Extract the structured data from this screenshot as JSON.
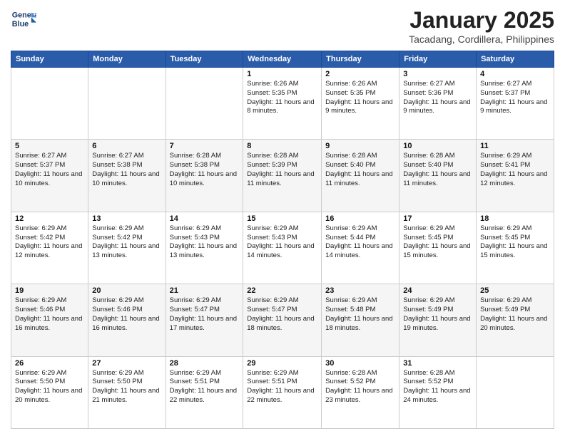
{
  "logo": {
    "line1": "General",
    "line2": "Blue"
  },
  "title": "January 2025",
  "location": "Tacadang, Cordillera, Philippines",
  "days_of_week": [
    "Sunday",
    "Monday",
    "Tuesday",
    "Wednesday",
    "Thursday",
    "Friday",
    "Saturday"
  ],
  "weeks": [
    [
      {
        "day": "",
        "sunrise": "",
        "sunset": "",
        "daylight": ""
      },
      {
        "day": "",
        "sunrise": "",
        "sunset": "",
        "daylight": ""
      },
      {
        "day": "",
        "sunrise": "",
        "sunset": "",
        "daylight": ""
      },
      {
        "day": "1",
        "sunrise": "Sunrise: 6:26 AM",
        "sunset": "Sunset: 5:35 PM",
        "daylight": "Daylight: 11 hours and 8 minutes."
      },
      {
        "day": "2",
        "sunrise": "Sunrise: 6:26 AM",
        "sunset": "Sunset: 5:35 PM",
        "daylight": "Daylight: 11 hours and 9 minutes."
      },
      {
        "day": "3",
        "sunrise": "Sunrise: 6:27 AM",
        "sunset": "Sunset: 5:36 PM",
        "daylight": "Daylight: 11 hours and 9 minutes."
      },
      {
        "day": "4",
        "sunrise": "Sunrise: 6:27 AM",
        "sunset": "Sunset: 5:37 PM",
        "daylight": "Daylight: 11 hours and 9 minutes."
      }
    ],
    [
      {
        "day": "5",
        "sunrise": "Sunrise: 6:27 AM",
        "sunset": "Sunset: 5:37 PM",
        "daylight": "Daylight: 11 hours and 10 minutes."
      },
      {
        "day": "6",
        "sunrise": "Sunrise: 6:27 AM",
        "sunset": "Sunset: 5:38 PM",
        "daylight": "Daylight: 11 hours and 10 minutes."
      },
      {
        "day": "7",
        "sunrise": "Sunrise: 6:28 AM",
        "sunset": "Sunset: 5:38 PM",
        "daylight": "Daylight: 11 hours and 10 minutes."
      },
      {
        "day": "8",
        "sunrise": "Sunrise: 6:28 AM",
        "sunset": "Sunset: 5:39 PM",
        "daylight": "Daylight: 11 hours and 11 minutes."
      },
      {
        "day": "9",
        "sunrise": "Sunrise: 6:28 AM",
        "sunset": "Sunset: 5:40 PM",
        "daylight": "Daylight: 11 hours and 11 minutes."
      },
      {
        "day": "10",
        "sunrise": "Sunrise: 6:28 AM",
        "sunset": "Sunset: 5:40 PM",
        "daylight": "Daylight: 11 hours and 11 minutes."
      },
      {
        "day": "11",
        "sunrise": "Sunrise: 6:29 AM",
        "sunset": "Sunset: 5:41 PM",
        "daylight": "Daylight: 11 hours and 12 minutes."
      }
    ],
    [
      {
        "day": "12",
        "sunrise": "Sunrise: 6:29 AM",
        "sunset": "Sunset: 5:42 PM",
        "daylight": "Daylight: 11 hours and 12 minutes."
      },
      {
        "day": "13",
        "sunrise": "Sunrise: 6:29 AM",
        "sunset": "Sunset: 5:42 PM",
        "daylight": "Daylight: 11 hours and 13 minutes."
      },
      {
        "day": "14",
        "sunrise": "Sunrise: 6:29 AM",
        "sunset": "Sunset: 5:43 PM",
        "daylight": "Daylight: 11 hours and 13 minutes."
      },
      {
        "day": "15",
        "sunrise": "Sunrise: 6:29 AM",
        "sunset": "Sunset: 5:43 PM",
        "daylight": "Daylight: 11 hours and 14 minutes."
      },
      {
        "day": "16",
        "sunrise": "Sunrise: 6:29 AM",
        "sunset": "Sunset: 5:44 PM",
        "daylight": "Daylight: 11 hours and 14 minutes."
      },
      {
        "day": "17",
        "sunrise": "Sunrise: 6:29 AM",
        "sunset": "Sunset: 5:45 PM",
        "daylight": "Daylight: 11 hours and 15 minutes."
      },
      {
        "day": "18",
        "sunrise": "Sunrise: 6:29 AM",
        "sunset": "Sunset: 5:45 PM",
        "daylight": "Daylight: 11 hours and 15 minutes."
      }
    ],
    [
      {
        "day": "19",
        "sunrise": "Sunrise: 6:29 AM",
        "sunset": "Sunset: 5:46 PM",
        "daylight": "Daylight: 11 hours and 16 minutes."
      },
      {
        "day": "20",
        "sunrise": "Sunrise: 6:29 AM",
        "sunset": "Sunset: 5:46 PM",
        "daylight": "Daylight: 11 hours and 16 minutes."
      },
      {
        "day": "21",
        "sunrise": "Sunrise: 6:29 AM",
        "sunset": "Sunset: 5:47 PM",
        "daylight": "Daylight: 11 hours and 17 minutes."
      },
      {
        "day": "22",
        "sunrise": "Sunrise: 6:29 AM",
        "sunset": "Sunset: 5:47 PM",
        "daylight": "Daylight: 11 hours and 18 minutes."
      },
      {
        "day": "23",
        "sunrise": "Sunrise: 6:29 AM",
        "sunset": "Sunset: 5:48 PM",
        "daylight": "Daylight: 11 hours and 18 minutes."
      },
      {
        "day": "24",
        "sunrise": "Sunrise: 6:29 AM",
        "sunset": "Sunset: 5:49 PM",
        "daylight": "Daylight: 11 hours and 19 minutes."
      },
      {
        "day": "25",
        "sunrise": "Sunrise: 6:29 AM",
        "sunset": "Sunset: 5:49 PM",
        "daylight": "Daylight: 11 hours and 20 minutes."
      }
    ],
    [
      {
        "day": "26",
        "sunrise": "Sunrise: 6:29 AM",
        "sunset": "Sunset: 5:50 PM",
        "daylight": "Daylight: 11 hours and 20 minutes."
      },
      {
        "day": "27",
        "sunrise": "Sunrise: 6:29 AM",
        "sunset": "Sunset: 5:50 PM",
        "daylight": "Daylight: 11 hours and 21 minutes."
      },
      {
        "day": "28",
        "sunrise": "Sunrise: 6:29 AM",
        "sunset": "Sunset: 5:51 PM",
        "daylight": "Daylight: 11 hours and 22 minutes."
      },
      {
        "day": "29",
        "sunrise": "Sunrise: 6:29 AM",
        "sunset": "Sunset: 5:51 PM",
        "daylight": "Daylight: 11 hours and 22 minutes."
      },
      {
        "day": "30",
        "sunrise": "Sunrise: 6:28 AM",
        "sunset": "Sunset: 5:52 PM",
        "daylight": "Daylight: 11 hours and 23 minutes."
      },
      {
        "day": "31",
        "sunrise": "Sunrise: 6:28 AM",
        "sunset": "Sunset: 5:52 PM",
        "daylight": "Daylight: 11 hours and 24 minutes."
      },
      {
        "day": "",
        "sunrise": "",
        "sunset": "",
        "daylight": ""
      }
    ]
  ]
}
